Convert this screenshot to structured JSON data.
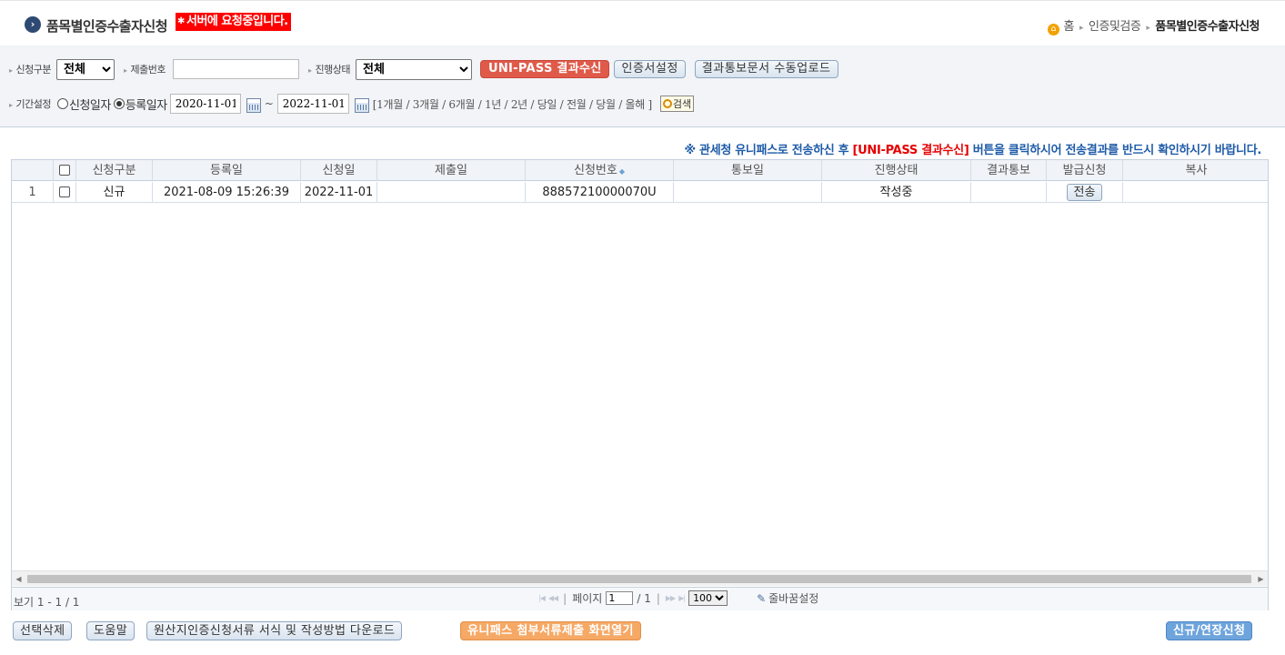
{
  "header": {
    "title": "품목별인증수출자신청",
    "loading_text": "서버에 요청중입니다.",
    "breadcrumb": [
      "홈",
      "인증및검증",
      "품목별인증수출자신청"
    ]
  },
  "search": {
    "apply_type_label": "신청구분",
    "apply_type_value": "전체",
    "submit_no_label": "제출번호",
    "submit_no_value": "",
    "status_label": "진행상태",
    "status_value": "전체",
    "unipass_button": "UNI-PASS 결과수신",
    "cert_setting_button": "인증서설정",
    "manual_upload_button": "결과통보문서 수동업로드",
    "period_label": "기간설정",
    "radio_apply_date": "신청일자",
    "radio_reg_date": "등록일자",
    "radio_selected": "등록일자",
    "date_from": "2020-11-01",
    "date_sep": "~",
    "date_to": "2022-11-01",
    "quick_open": "[",
    "quick_ranges": [
      "1개월",
      "3개월",
      "6개월",
      "1년",
      "2년",
      "당일",
      "전월",
      "당월",
      "올해"
    ],
    "quick_close": "]",
    "search_button": "검색"
  },
  "notice": {
    "prefix": "※ 관세청 유니패스로 전송하신 후 ",
    "highlight": "[UNI-PASS 결과수신]",
    "suffix": " 버튼을 클릭하시어 전송결과를 반드시 확인하시기 바랍니다."
  },
  "grid": {
    "columns": [
      "",
      "",
      "신청구분",
      "등록일",
      "신청일",
      "제출일",
      "신청번호",
      "통보일",
      "진행상태",
      "결과통보",
      "발급신청",
      "복사"
    ],
    "rows": [
      {
        "no": "1",
        "apply_type": "신규",
        "reg_date": "2021-08-09 15:26:39",
        "apply_date": "2022-11-01",
        "submit_date": "",
        "apply_no": "88857210000070U",
        "notice_date": "",
        "status": "작성중",
        "result": "",
        "issue_button": "전송",
        "copy": ""
      }
    ]
  },
  "pager": {
    "record_info": "보기 1 - 1 / 1",
    "page_label": "페이지",
    "current_page": "1",
    "total_pages": "/ 1",
    "page_size": "100",
    "wrap_setting": "줄바꿈설정"
  },
  "footer": {
    "delete_button": "선택삭제",
    "help_button": "도움말",
    "download_button": "원산지인증신청서류 서식 및 작성방법 다운로드",
    "unipass_attach_button": "유니패스 첨부서류제출 화면열기",
    "new_button": "신규/연장신청"
  }
}
